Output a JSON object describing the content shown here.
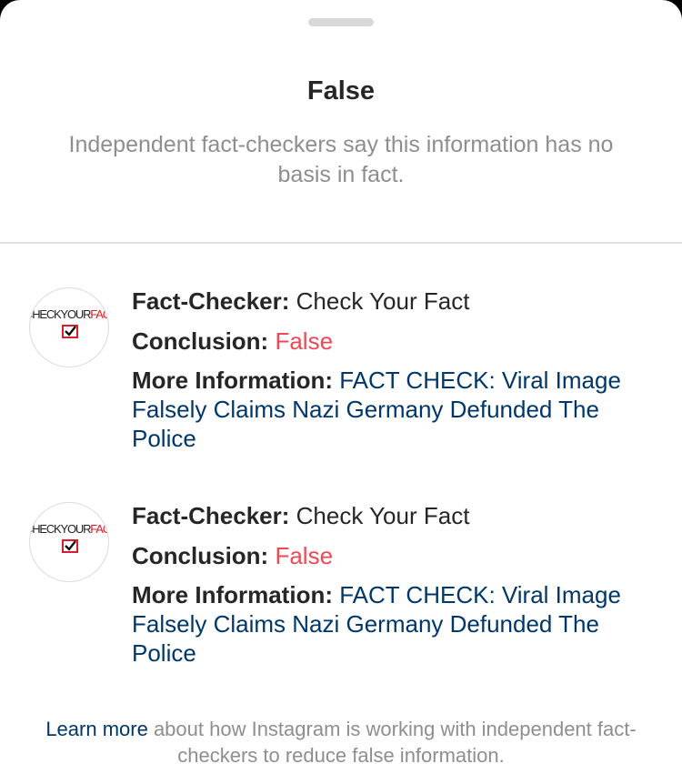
{
  "sheet": {
    "title": "False",
    "subtitle": "Independent fact-checkers say this information has no basis in fact."
  },
  "entries": [
    {
      "logo_text_left": "CHECKYOUR",
      "logo_text_right": "FACT",
      "logo_icon": "checkbox-icon",
      "fact_checker_label": "Fact-Checker:",
      "fact_checker_value": "Check Your Fact",
      "conclusion_label": "Conclusion:",
      "conclusion_value": "False",
      "more_label": "More Information:",
      "more_link": "FACT CHECK: Viral Image Falsely Claims Nazi Germany Defunded The Police"
    },
    {
      "logo_text_left": "CHECKYOUR",
      "logo_text_right": "FACT",
      "logo_icon": "checkbox-icon",
      "fact_checker_label": "Fact-Checker:",
      "fact_checker_value": "Check Your Fact",
      "conclusion_label": "Conclusion:",
      "conclusion_value": "False",
      "more_label": "More Information:",
      "more_link": "FACT CHECK: Viral Image Falsely Claims Nazi Germany Defunded The Police"
    }
  ],
  "footer": {
    "link": "Learn more",
    "text": " about how Instagram is working with independent fact-checkers to reduce false information."
  },
  "colors": {
    "title": "#262626",
    "muted": "#8e8e8e",
    "link": "#00376b",
    "false_red": "#ed4956",
    "logo_red": "#d51f2c"
  }
}
